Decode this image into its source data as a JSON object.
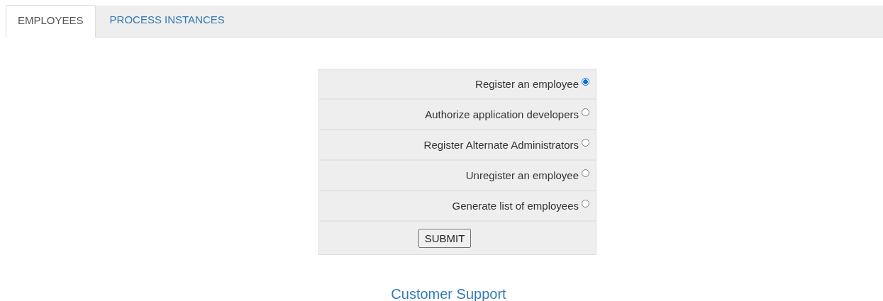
{
  "tabs": [
    {
      "label": "EMPLOYEES",
      "selected": true
    },
    {
      "label": "PROCESS INSTANCES",
      "selected": false
    }
  ],
  "options": [
    {
      "label": "Register an employee",
      "selected": true
    },
    {
      "label": "Authorize application developers",
      "selected": false
    },
    {
      "label": "Register Alternate Administrators",
      "selected": false
    },
    {
      "label": "Unregister an employee",
      "selected": false
    },
    {
      "label": "Generate list of employees",
      "selected": false
    }
  ],
  "submit_button": "SUBMIT",
  "footer_link": "Customer Support"
}
